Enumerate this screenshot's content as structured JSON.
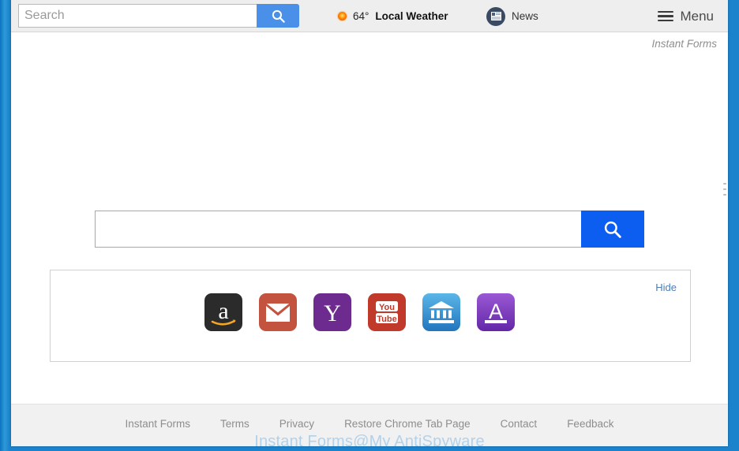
{
  "toolbar": {
    "search_placeholder": "Search",
    "search_value": "",
    "search_button_icon": "search-icon",
    "weather": {
      "icon": "sun-icon",
      "temperature": "64°",
      "label": "Local Weather"
    },
    "news": {
      "icon": "newspaper-icon",
      "label": "News"
    },
    "menu": {
      "icon": "hamburger-icon",
      "label": "Menu"
    }
  },
  "brand": {
    "mark": "Instant Forms"
  },
  "hero": {
    "search_value": "",
    "search_placeholder": "",
    "search_button_icon": "search-icon",
    "button_color": "#0b5ef0"
  },
  "shortcuts": {
    "hide_label": "Hide",
    "items": [
      {
        "name": "amazon",
        "label": "Amazon",
        "icon": "amazon-icon",
        "color": "#2b2b2b"
      },
      {
        "name": "gmail",
        "label": "Gmail",
        "icon": "gmail-icon",
        "color": "#c3533f"
      },
      {
        "name": "yahoo",
        "label": "Yahoo",
        "icon": "yahoo-icon",
        "color": "#6d2b8f"
      },
      {
        "name": "youtube",
        "label": "YouTube",
        "icon": "youtube-icon",
        "color": "#c0392b"
      },
      {
        "name": "bank",
        "label": "Bank",
        "icon": "bank-icon",
        "color": "#2f8fd0"
      },
      {
        "name": "answers",
        "label": "Answers",
        "icon": "letter-a-icon",
        "color": "#7430b8"
      }
    ]
  },
  "footer": {
    "links": [
      "Instant Forms",
      "Terms",
      "Privacy",
      "Restore Chrome Tab Page",
      "Contact",
      "Feedback"
    ]
  },
  "watermark": {
    "text": "Instant Forms@My AntiSpyware",
    "color": "#9ec7e8"
  }
}
